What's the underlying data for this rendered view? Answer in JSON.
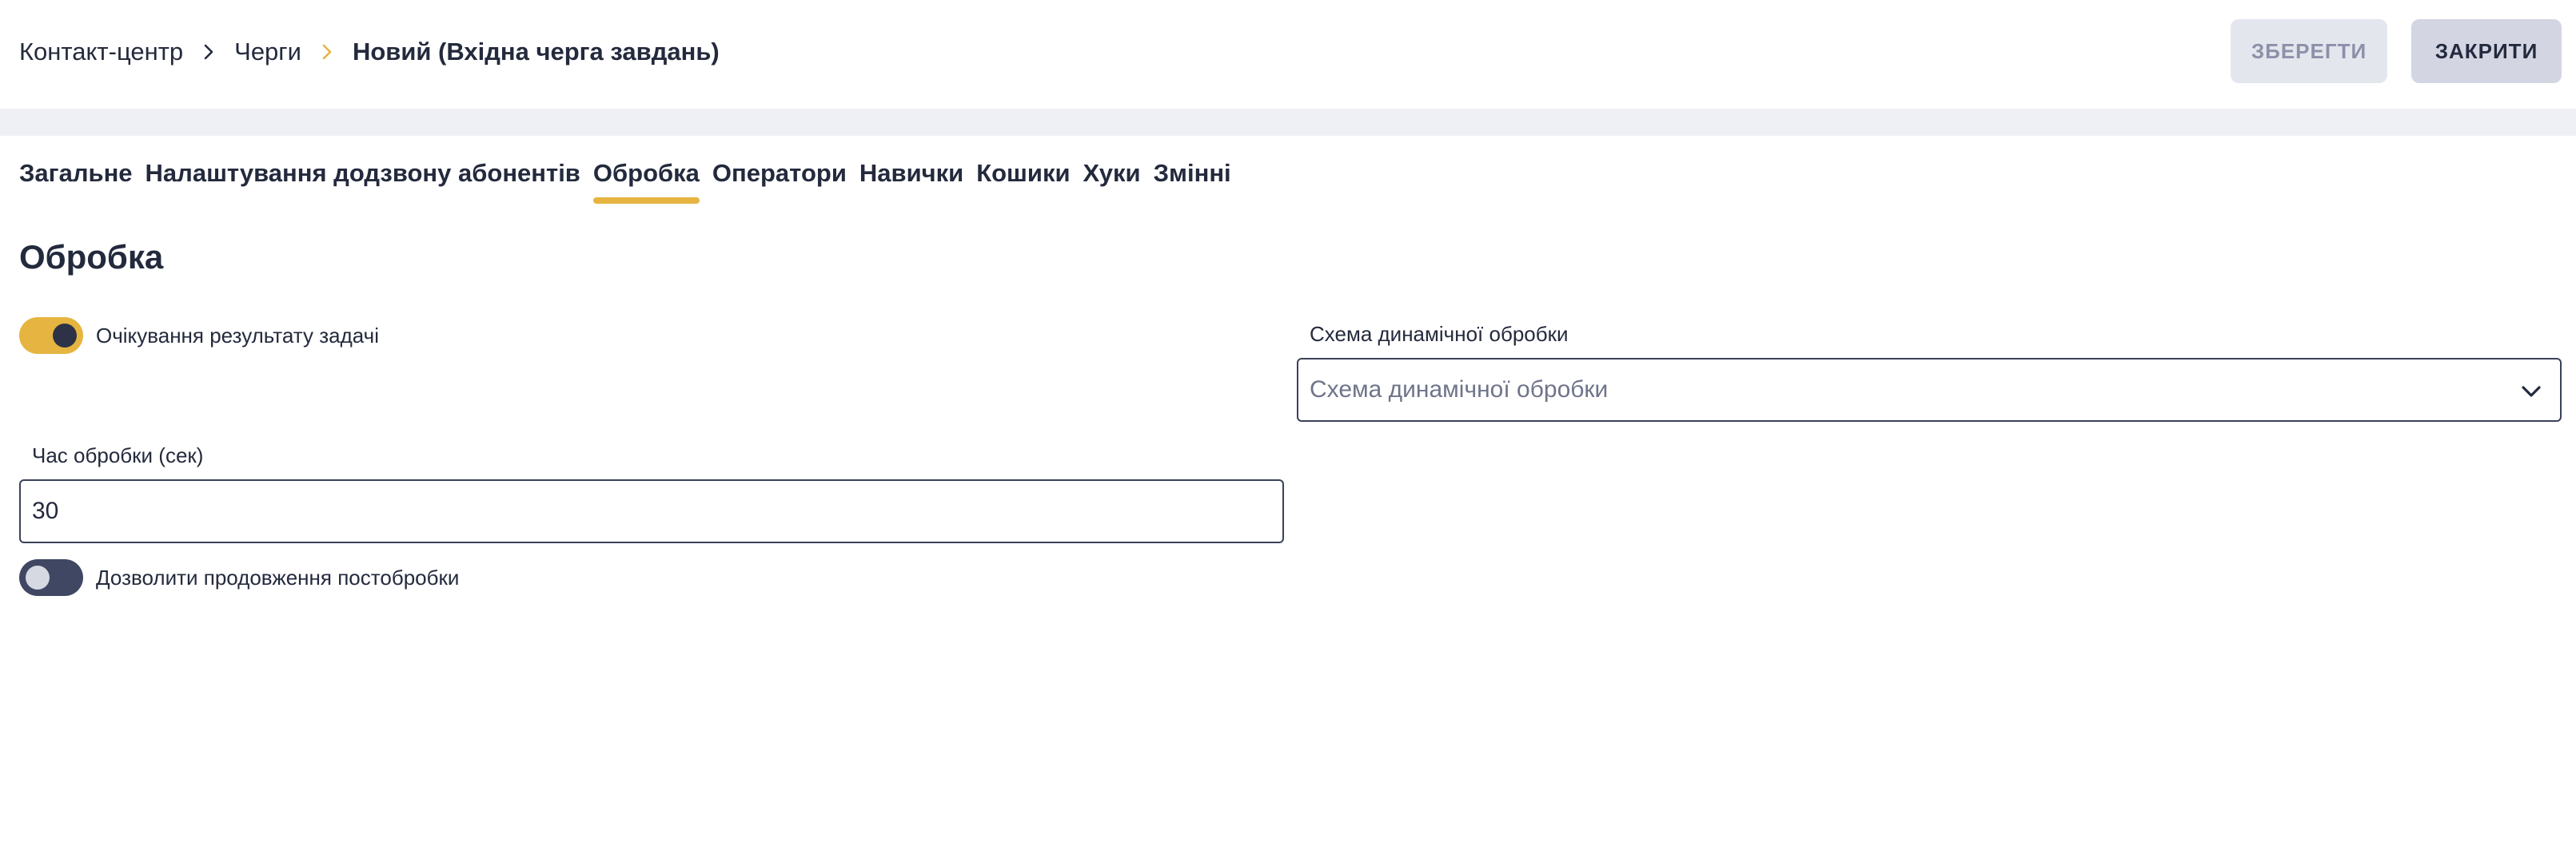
{
  "breadcrumb": {
    "items": [
      "Контакт-центр",
      "Черги",
      "Новий (Вхідна черга завдань)"
    ]
  },
  "header": {
    "save_label": "ЗБЕРЕГТИ",
    "close_label": "ЗАКРИТИ"
  },
  "tabs": [
    {
      "label": "Загальне",
      "active": false
    },
    {
      "label": "Налаштування додзвону абонентів",
      "active": false
    },
    {
      "label": "Обробка",
      "active": true
    },
    {
      "label": "Оператори",
      "active": false
    },
    {
      "label": "Навички",
      "active": false
    },
    {
      "label": "Кошики",
      "active": false
    },
    {
      "label": "Хуки",
      "active": false
    },
    {
      "label": "Змінні",
      "active": false
    }
  ],
  "section": {
    "title": "Обробка"
  },
  "form": {
    "wait_result": {
      "label": "Очікування результату задачі",
      "enabled": true
    },
    "dynamic_schema": {
      "label": "Схема динамічної обробки",
      "placeholder": "Схема динамічної обробки"
    },
    "processing_time": {
      "label": "Час обробки (сек)",
      "value": "30"
    },
    "allow_postprocessing": {
      "label": "Дозволити продовження постобробки",
      "enabled": false
    }
  },
  "colors": {
    "accent": "#e6b440",
    "text": "#242a3d",
    "band": "#eff0f5",
    "toggle_off": "#3f4763"
  }
}
